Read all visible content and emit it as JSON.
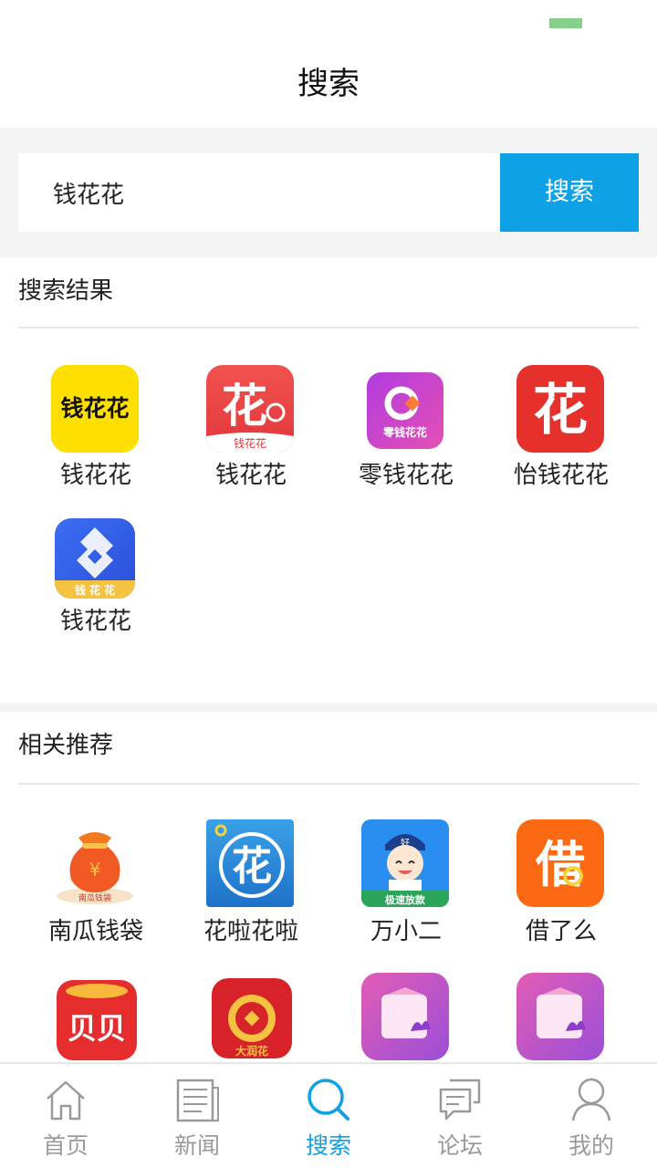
{
  "title": "搜索",
  "search": {
    "value": "钱花花",
    "button": "搜索"
  },
  "results": {
    "heading": "搜索结果",
    "apps": [
      {
        "name": "钱花花",
        "icon": "qianhuahua-yellow-icon"
      },
      {
        "name": "钱花花",
        "icon": "qianhuahua-red-icon"
      },
      {
        "name": "零钱花花",
        "icon": "lingqian-huahua-icon"
      },
      {
        "name": "怡钱花花",
        "icon": "yiqian-huahua-icon"
      },
      {
        "name": "钱花花",
        "icon": "qianhuahua-blue-icon"
      }
    ],
    "icon_text": {
      "yellow": "钱花花",
      "red_big": "花",
      "red_ribbon": "钱花花",
      "purple": "零钱花花",
      "crimson": "花",
      "blue_band": "钱 花 花"
    }
  },
  "recommendations": {
    "heading": "相关推荐",
    "apps": [
      {
        "name": "南瓜钱袋",
        "icon": "money-bag-icon"
      },
      {
        "name": "花啦花啦",
        "icon": "hua-circle-icon"
      },
      {
        "name": "万小二",
        "icon": "waiter-icon"
      },
      {
        "name": "借了么",
        "icon": "jie-icon"
      },
      {
        "name": "",
        "icon": "beibei-icon"
      },
      {
        "name": "",
        "icon": "coin-icon"
      },
      {
        "name": "",
        "icon": "wallet-icon"
      },
      {
        "name": "",
        "icon": "wallet-icon"
      }
    ],
    "icon_text": {
      "bag_ribbon": "南瓜钱袋",
      "hua": "花",
      "waiter_band": "极速放款",
      "waiter_hat": "好",
      "jie": "借",
      "beibei": "贝贝",
      "coin_band": "大润花",
      "yen": "¥"
    }
  },
  "tabbar": {
    "tabs": [
      {
        "label": "首页",
        "icon": "home-icon"
      },
      {
        "label": "新闻",
        "icon": "news-icon"
      },
      {
        "label": "搜索",
        "icon": "search-icon"
      },
      {
        "label": "论坛",
        "icon": "forum-icon"
      },
      {
        "label": "我的",
        "icon": "profile-icon"
      }
    ],
    "active": 2
  },
  "colors": {
    "accent": "#0ea1e6",
    "tab_inactive": "#9a9a9a",
    "battery": "#86d08b"
  }
}
